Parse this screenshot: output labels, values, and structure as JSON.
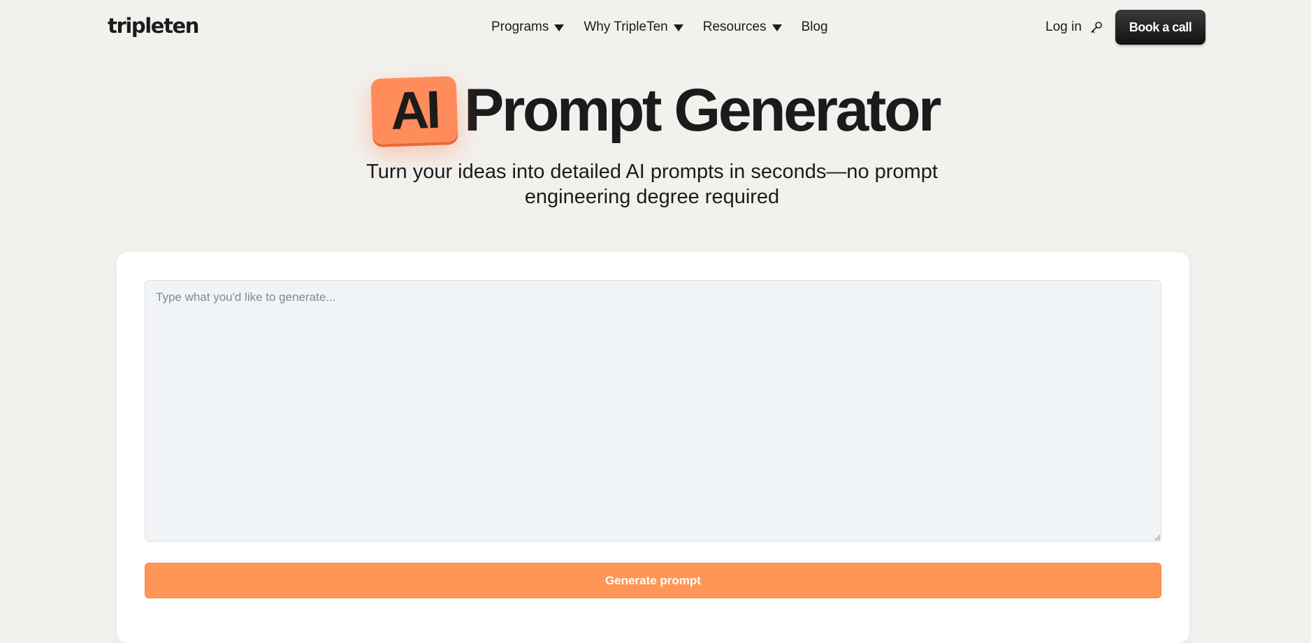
{
  "nav": {
    "logo": "tripleten",
    "menu": [
      {
        "label": "Programs",
        "has_dropdown": true
      },
      {
        "label": "Why TripleTen",
        "has_dropdown": true
      },
      {
        "label": "Resources",
        "has_dropdown": true
      },
      {
        "label": "Blog",
        "has_dropdown": false
      }
    ],
    "login_label": "Log in",
    "login_icon": "key-icon",
    "cta_label": "Book a call"
  },
  "hero": {
    "badge": "AI",
    "title": "Prompt Generator",
    "subtitle": "Turn your ideas into detailed AI prompts in seconds—no prompt engineering degree required"
  },
  "generator": {
    "input_value": "",
    "input_placeholder": "Type what you'd like to generate...",
    "button_label": "Generate prompt"
  },
  "colors": {
    "background": "#f2f1ee",
    "accent": "#ff9657",
    "badge": "#ff8c5a",
    "cta": "#1b1b1b",
    "input_bg": "#f1f4f7"
  }
}
